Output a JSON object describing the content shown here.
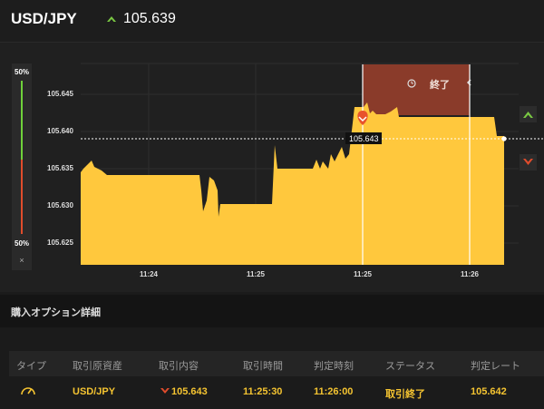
{
  "header": {
    "pair": "USD/JPY",
    "price": "105.639",
    "price_icon": "up-chevron-icon",
    "price_color": "#7ac943"
  },
  "meter": {
    "top_label": "50%",
    "bottom_label": "50%",
    "close_label": "×",
    "up_fraction": 0.5,
    "down_fraction": 0.5,
    "up_color": "#6fd13a",
    "down_color": "#e04c2c"
  },
  "chart": {
    "y_ticks": [
      "105.645",
      "105.640",
      "105.635",
      "105.630",
      "105.625"
    ],
    "x_ticks": [
      "11:24",
      "11:25",
      "11:25",
      "11:26"
    ],
    "current_price_label": "105.643",
    "end_banner_label": "終了",
    "end_banner_icon": "timer-icon",
    "up_button_icon": "up-chevron-icon",
    "down_button_icon": "down-chevron-icon",
    "entry_marker_icon": "down-arrow-icon",
    "area_color": "#ffc83d",
    "banner_color": "#8a3b2a"
  },
  "details": {
    "title": "購入オプション詳細"
  },
  "table": {
    "headers": [
      "タイプ",
      "取引原資産",
      "取引内容",
      "取引時間",
      "判定時刻",
      "ステータス",
      "判定レート"
    ],
    "row": {
      "type_icon": "gauge-icon",
      "asset": "USD/JPY",
      "direction_icon": "down-chevron-icon",
      "content": "105.643",
      "trade_time": "11:25:30",
      "judge_time": "11:26:00",
      "status": "取引終了",
      "judge_rate": "105.642"
    }
  }
}
